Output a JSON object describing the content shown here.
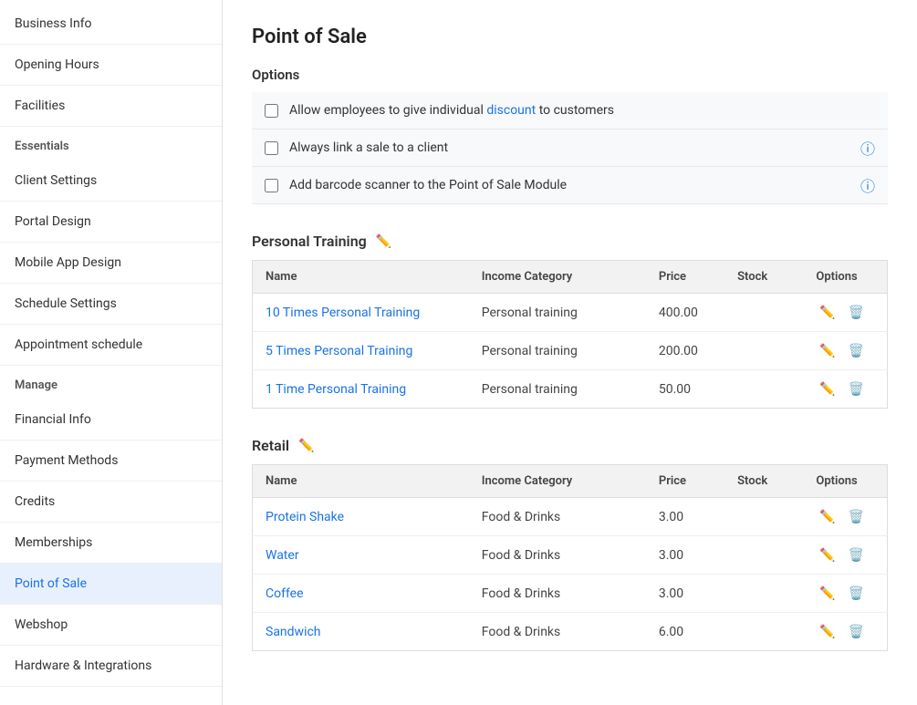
{
  "sidebar": {
    "sections": [
      {
        "type": "items",
        "items": [
          {
            "id": "business-info",
            "label": "Business Info",
            "active": false
          },
          {
            "id": "opening-hours",
            "label": "Opening Hours",
            "active": false
          },
          {
            "id": "facilities",
            "label": "Facilities",
            "active": false
          }
        ]
      },
      {
        "type": "header",
        "label": "Essentials"
      },
      {
        "type": "items",
        "items": [
          {
            "id": "client-settings",
            "label": "Client Settings",
            "active": false
          },
          {
            "id": "portal-design",
            "label": "Portal Design",
            "active": false
          },
          {
            "id": "mobile-app-design",
            "label": "Mobile App Design",
            "active": false
          },
          {
            "id": "schedule-settings",
            "label": "Schedule Settings",
            "active": false
          },
          {
            "id": "appointment-schedule",
            "label": "Appointment schedule",
            "active": false
          }
        ]
      },
      {
        "type": "header",
        "label": "Manage"
      },
      {
        "type": "items",
        "items": [
          {
            "id": "financial-info",
            "label": "Financial Info",
            "active": false
          },
          {
            "id": "payment-methods",
            "label": "Payment Methods",
            "active": false
          },
          {
            "id": "credits",
            "label": "Credits",
            "active": false
          },
          {
            "id": "memberships",
            "label": "Memberships",
            "active": false
          },
          {
            "id": "point-of-sale",
            "label": "Point of Sale",
            "active": true
          },
          {
            "id": "webshop",
            "label": "Webshop",
            "active": false
          },
          {
            "id": "hardware-integrations",
            "label": "Hardware & Integrations",
            "active": false
          }
        ]
      }
    ]
  },
  "main": {
    "page_title": "Point of Sale",
    "options_title": "Options",
    "options": [
      {
        "id": "discount-option",
        "label_parts": [
          {
            "text": "Allow employees to give individual ",
            "type": "normal"
          },
          {
            "text": "discount",
            "type": "link"
          },
          {
            "text": " to customers",
            "type": "normal"
          }
        ],
        "has_info": false
      },
      {
        "id": "link-sale-option",
        "label": "Always link a sale to a client",
        "has_info": true
      },
      {
        "id": "barcode-option",
        "label": "Add barcode scanner to the Point of Sale Module",
        "has_info": true
      }
    ],
    "categories": [
      {
        "id": "personal-training",
        "title": "Personal Training",
        "columns": [
          "Name",
          "Income Category",
          "Price",
          "Stock",
          "Options"
        ],
        "rows": [
          {
            "name": "10 Times Personal Training",
            "income_category": "Personal training",
            "price": "400.00",
            "stock": ""
          },
          {
            "name": "5 Times Personal Training",
            "income_category": "Personal training",
            "price": "200.00",
            "stock": ""
          },
          {
            "name": "1 Time Personal Training",
            "income_category": "Personal training",
            "price": "50.00",
            "stock": ""
          }
        ]
      },
      {
        "id": "retail",
        "title": "Retail",
        "columns": [
          "Name",
          "Income Category",
          "Price",
          "Stock",
          "Options"
        ],
        "rows": [
          {
            "name": "Protein Shake",
            "income_category": "Food & Drinks",
            "price": "3.00",
            "stock": ""
          },
          {
            "name": "Water",
            "income_category": "Food & Drinks",
            "price": "3.00",
            "stock": ""
          },
          {
            "name": "Coffee",
            "income_category": "Food & Drinks",
            "price": "3.00",
            "stock": ""
          },
          {
            "name": "Sandwich",
            "income_category": "Food & Drinks",
            "price": "6.00",
            "stock": ""
          }
        ]
      }
    ]
  }
}
